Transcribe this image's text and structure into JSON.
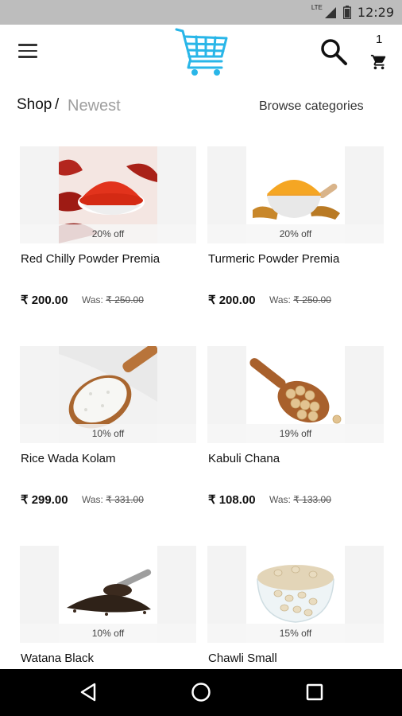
{
  "status_bar": {
    "network": "LTE",
    "time": "12:29"
  },
  "header": {
    "cart_count": "1"
  },
  "breadcrumb": {
    "shop": "Shop",
    "separator": "/",
    "current": "Newest"
  },
  "browse_label": "Browse categories",
  "products": [
    {
      "name": "Red Chilly Powder Premia",
      "discount": "20% off",
      "price": "₹ 200.00",
      "was_label": "Was:",
      "was_price": "₹ 250.00"
    },
    {
      "name": "Turmeric Powder Premia",
      "discount": "20% off",
      "price": "₹ 200.00",
      "was_label": "Was:",
      "was_price": "₹ 250.00"
    },
    {
      "name": "Rice Wada Kolam",
      "discount": "10% off",
      "price": "₹ 299.00",
      "was_label": "Was:",
      "was_price": "₹ 331.00"
    },
    {
      "name": "Kabuli Chana",
      "discount": "19% off",
      "price": "₹ 108.00",
      "was_label": "Was:",
      "was_price": "₹ 133.00"
    },
    {
      "name": "Watana Black",
      "discount": "10% off"
    },
    {
      "name": "Chawli Small",
      "discount": "15% off"
    }
  ],
  "colors": {
    "logo": "#29b6e8",
    "muted_text": "#9e9e9e",
    "status_bar": "#bdbdbd",
    "nav_bar": "#000000"
  }
}
